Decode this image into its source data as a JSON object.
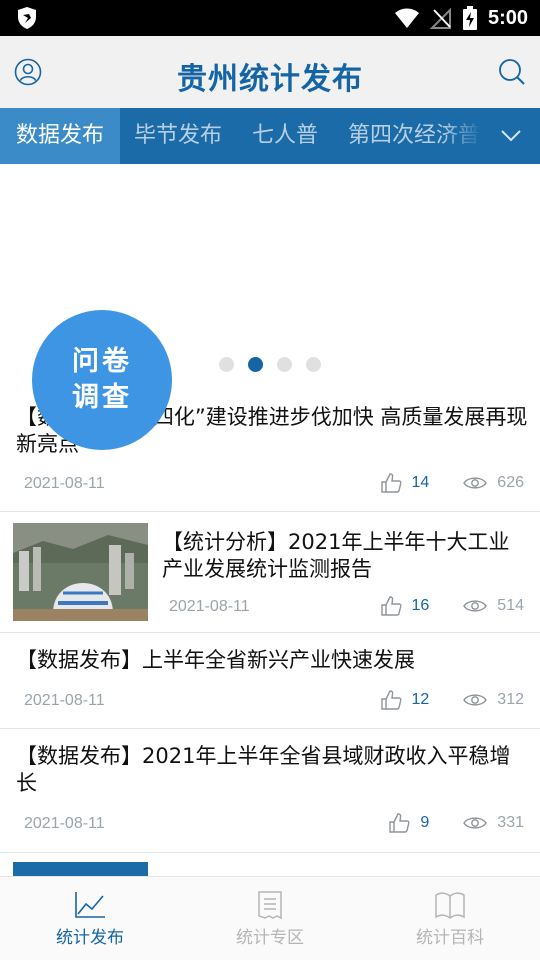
{
  "status_bar": {
    "time": "5:00"
  },
  "header": {
    "title": "贵州统计发布"
  },
  "tabs": [
    {
      "label": "数据发布"
    },
    {
      "label": "毕节发布"
    },
    {
      "label": "七人普"
    },
    {
      "label": "第四次经济普"
    }
  ],
  "survey": {
    "line1": "问卷",
    "line2": "调查"
  },
  "articles": [
    {
      "title": "【数据发布】“四化”建设推进步伐加快  高质量发展再现新亮点",
      "date": "2021-08-11",
      "likes": "14",
      "views": "626"
    },
    {
      "title": "【统计分析】2021年上半年十大工业产业发展统计监测报告",
      "date": "2021-08-11",
      "likes": "16",
      "views": "514"
    },
    {
      "title": "【数据发布】上半年全省新兴产业快速发展",
      "date": "2021-08-11",
      "likes": "12",
      "views": "312"
    },
    {
      "title": "【数据发布】2021年上半年全省县域财政收入平稳增长",
      "date": "2021-08-11",
      "likes": "9",
      "views": "331"
    }
  ],
  "bottom_nav": [
    {
      "label": "统计发布",
      "icon": "line-chart-icon"
    },
    {
      "label": "统计专区",
      "icon": "document-icon"
    },
    {
      "label": "统计百科",
      "icon": "book-icon"
    }
  ],
  "colors": {
    "primary": "#1565a6",
    "tab_bar": "#1a6ba8",
    "survey": "#3d95e4"
  }
}
